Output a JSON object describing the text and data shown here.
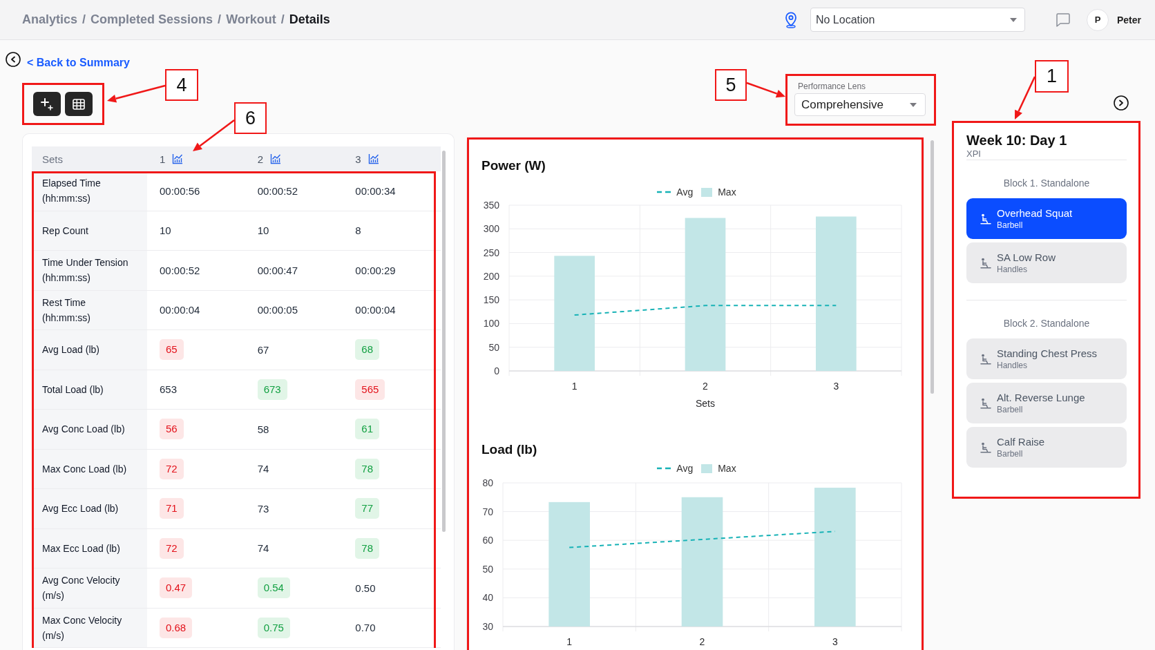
{
  "header": {
    "breadcrumb": {
      "separator": "/",
      "items": [
        {
          "label": "Analytics",
          "current": false
        },
        {
          "label": "Completed Sessions",
          "current": false
        },
        {
          "label": "Workout",
          "current": false
        },
        {
          "label": "Details",
          "current": true
        }
      ]
    },
    "location_select": {
      "value": "No Location"
    },
    "user": {
      "initial": "P",
      "name": "Peter"
    }
  },
  "back_link": "< Back to Summary",
  "toolbar": {
    "annotated": true,
    "callout": "4",
    "buttons": [
      {
        "kind": "add"
      },
      {
        "kind": "table"
      }
    ]
  },
  "performance_lens": {
    "annotated": true,
    "callout": "5",
    "label": "Performance Lens",
    "value": "Comprehensive"
  },
  "sets_table": {
    "annotated": true,
    "callout": "6",
    "header": "Sets",
    "sets": [
      "1",
      "2",
      "3"
    ],
    "rows": [
      {
        "label": "Elapsed Time (hh:mm:ss)",
        "cells": [
          {
            "value": "00:00:56",
            "kind": "plain"
          },
          {
            "value": "00:00:52",
            "kind": "plain"
          },
          {
            "value": "00:00:34",
            "kind": "plain"
          }
        ]
      },
      {
        "label": "Rep Count",
        "cells": [
          {
            "value": "10",
            "kind": "plain"
          },
          {
            "value": "10",
            "kind": "plain"
          },
          {
            "value": "8",
            "kind": "plain"
          }
        ]
      },
      {
        "label": "Time Under Tension (hh:mm:ss)",
        "cells": [
          {
            "value": "00:00:52",
            "kind": "plain"
          },
          {
            "value": "00:00:47",
            "kind": "plain"
          },
          {
            "value": "00:00:29",
            "kind": "plain"
          }
        ]
      },
      {
        "label": "Rest Time (hh:mm:ss)",
        "cells": [
          {
            "value": "00:00:04",
            "kind": "plain"
          },
          {
            "value": "00:00:05",
            "kind": "plain"
          },
          {
            "value": "00:00:04",
            "kind": "plain"
          }
        ]
      },
      {
        "label": "Avg Load (lb)",
        "cells": [
          {
            "value": "65",
            "kind": "low"
          },
          {
            "value": "67",
            "kind": "plain"
          },
          {
            "value": "68",
            "kind": "high"
          }
        ]
      },
      {
        "label": "Total Load (lb)",
        "cells": [
          {
            "value": "653",
            "kind": "plain"
          },
          {
            "value": "673",
            "kind": "high"
          },
          {
            "value": "565",
            "kind": "low"
          }
        ]
      },
      {
        "label": "Avg Conc Load (lb)",
        "cells": [
          {
            "value": "56",
            "kind": "low"
          },
          {
            "value": "58",
            "kind": "plain"
          },
          {
            "value": "61",
            "kind": "high"
          }
        ]
      },
      {
        "label": "Max Conc Load (lb)",
        "cells": [
          {
            "value": "72",
            "kind": "low"
          },
          {
            "value": "74",
            "kind": "plain"
          },
          {
            "value": "78",
            "kind": "high"
          }
        ]
      },
      {
        "label": "Avg Ecc Load (lb)",
        "cells": [
          {
            "value": "71",
            "kind": "low"
          },
          {
            "value": "73",
            "kind": "plain"
          },
          {
            "value": "77",
            "kind": "high"
          }
        ]
      },
      {
        "label": "Max Ecc Load (lb)",
        "cells": [
          {
            "value": "72",
            "kind": "low"
          },
          {
            "value": "74",
            "kind": "plain"
          },
          {
            "value": "78",
            "kind": "high"
          }
        ]
      },
      {
        "label": "Avg Conc Velocity (m/s)",
        "cells": [
          {
            "value": "0.47",
            "kind": "low"
          },
          {
            "value": "0.54",
            "kind": "high"
          },
          {
            "value": "0.50",
            "kind": "plain"
          }
        ]
      },
      {
        "label": "Max Conc Velocity (m/s)",
        "cells": [
          {
            "value": "0.68",
            "kind": "low"
          },
          {
            "value": "0.75",
            "kind": "high"
          },
          {
            "value": "0.70",
            "kind": "plain"
          }
        ]
      }
    ]
  },
  "charts": {
    "annotated": true,
    "items": [
      {
        "chart_data": {
          "type": "bar",
          "title": "Power (W)",
          "xlabel": "Sets",
          "categories": [
            "1",
            "2",
            "3"
          ],
          "series": [
            {
              "name": "Avg",
              "type": "line",
              "line_style": "dashed",
              "color": "#17b2b6",
              "values": [
                118,
                138,
                138
              ]
            },
            {
              "name": "Max",
              "type": "bar",
              "color": "#c2e6e7",
              "values": [
                243,
                323,
                326
              ]
            }
          ],
          "ylim": [
            0,
            350
          ],
          "yticks": [
            0,
            50,
            100,
            150,
            200,
            250,
            300,
            350
          ],
          "grid": true,
          "legend": true
        }
      },
      {
        "chart_data": {
          "type": "bar",
          "title": "Load (lb)",
          "categories": [
            "1",
            "2",
            "3"
          ],
          "series": [
            {
              "name": "Avg",
              "type": "line",
              "line_style": "dashed",
              "color": "#17b2b6",
              "values": [
                57.5,
                60.3,
                63.1
              ]
            },
            {
              "name": "Max",
              "type": "bar",
              "color": "#c2e6e7",
              "values": [
                73.3,
                75,
                78.3
              ]
            }
          ],
          "ylim": [
            30,
            80
          ],
          "yticks": [
            30,
            40,
            50,
            60,
            70,
            80
          ],
          "grid": true,
          "legend": true
        }
      }
    ]
  },
  "workout_panel": {
    "annotated": true,
    "callout": "1",
    "title": "Week 10: Day 1",
    "subtitle": "XPI",
    "blocks": [
      {
        "title": "Block 1. Standalone",
        "exercises": [
          {
            "name": "Overhead Squat",
            "equipment": "Barbell",
            "selected": true
          },
          {
            "name": "SA Low Row",
            "equipment": "Handles",
            "selected": false
          }
        ]
      },
      {
        "title": "Block 2. Standalone",
        "exercises": [
          {
            "name": "Standing Chest Press",
            "equipment": "Handles",
            "selected": false
          },
          {
            "name": "Alt. Reverse Lunge",
            "equipment": "Barbell",
            "selected": false
          },
          {
            "name": "Calf Raise",
            "equipment": "Barbell",
            "selected": false
          }
        ]
      }
    ]
  }
}
